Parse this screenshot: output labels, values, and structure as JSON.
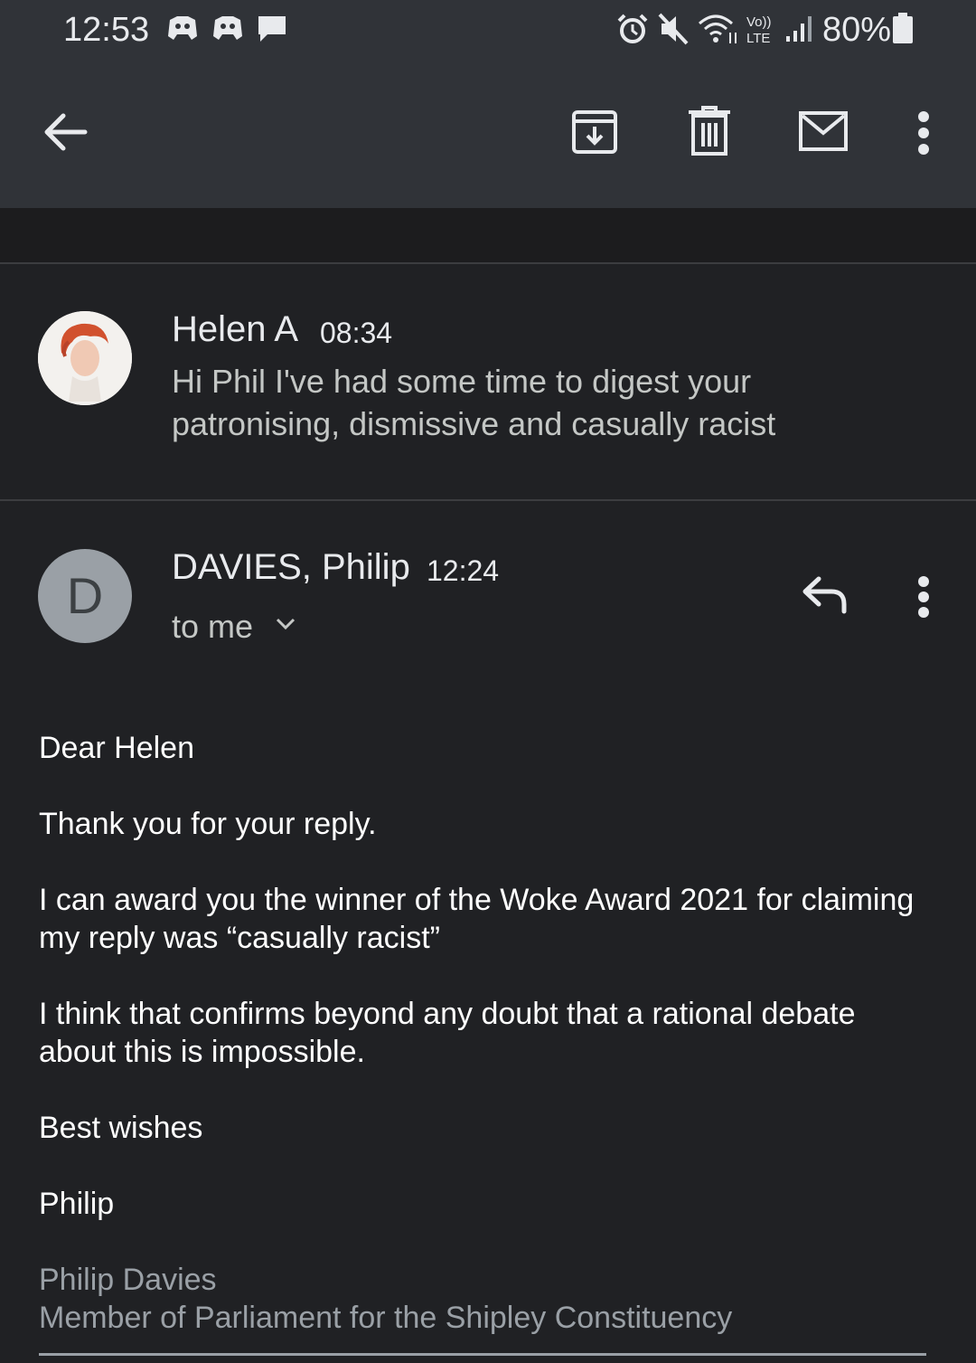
{
  "status_bar": {
    "time": "12:53",
    "battery": "80%",
    "notification_icons": [
      "discord-icon",
      "discord-icon",
      "chat-bubble-icon"
    ],
    "system_icons": [
      "alarm-icon",
      "mute-icon",
      "wifi-icon",
      "volte-icon",
      "signal-icon",
      "battery-icon"
    ]
  },
  "toolbar": {
    "actions": [
      "back-arrow-icon",
      "archive-icon",
      "delete-icon",
      "mark-unread-icon",
      "more-icon"
    ]
  },
  "thread": [
    {
      "sender": "Helen A",
      "time": "08:34",
      "snippet": "Hi Phil I've had some time to digest your patronising, dismissive and casually racist"
    },
    {
      "sender": "DAVIES, Philip",
      "time": "12:24",
      "avatar_letter": "D",
      "recipient": "to me",
      "body": [
        "Dear Helen",
        "Thank you for your reply.",
        "I can award you the winner of the Woke Award 2021 for claiming my reply was “casually racist”",
        "I think that confirms beyond any doubt that a rational debate about this is impossible.",
        "Best wishes",
        "Philip"
      ],
      "signature": [
        "Philip Davies",
        "Member of Parliament for the Shipley Constituency"
      ]
    }
  ],
  "colors": {
    "toolbar_bg": "#303338",
    "background": "#202124",
    "avatar_grey": "#9aa0a6",
    "text_primary": "#e8eaed",
    "signature_text": "#9aa0a6"
  }
}
